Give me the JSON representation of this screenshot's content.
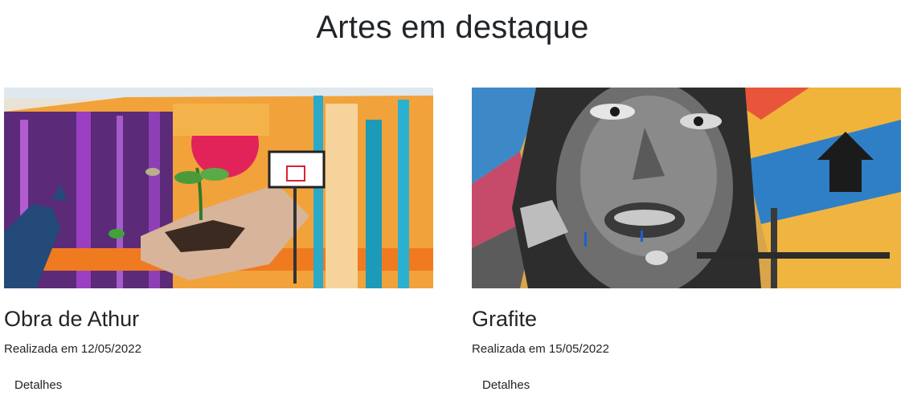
{
  "page": {
    "title": "Artes em destaque"
  },
  "cards": [
    {
      "title": "Obra de Athur",
      "date": "Realizada em 12/05/2022",
      "link": "Detalhes"
    },
    {
      "title": "Grafite",
      "date": "Realizada em 15/05/2022",
      "link": "Detalhes"
    }
  ]
}
